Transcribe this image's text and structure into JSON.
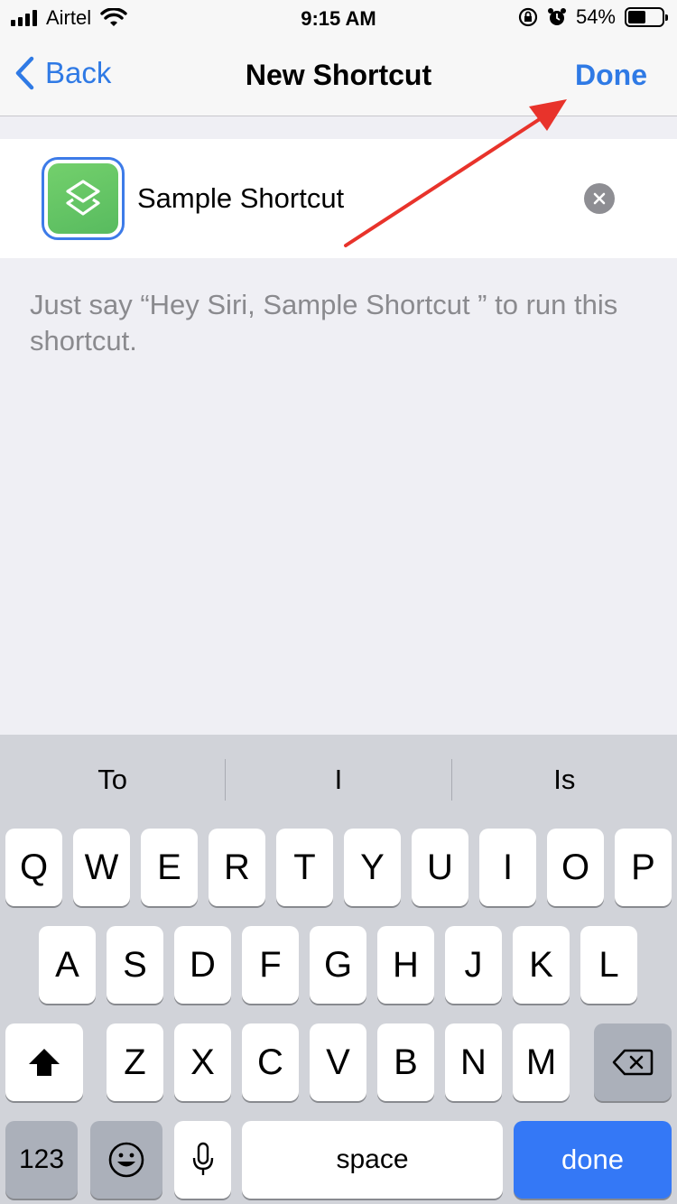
{
  "status_bar": {
    "carrier": "Airtel",
    "time": "9:15 AM",
    "battery_percent": "54%",
    "battery_level": 0.54
  },
  "nav": {
    "back_label": "Back",
    "title": "New Shortcut",
    "done_label": "Done"
  },
  "shortcut": {
    "name_value": "Sample Shortcut",
    "hint": "Just say “Hey Siri, Sample Shortcut ” to run this shortcut."
  },
  "keyboard": {
    "suggestions": [
      "To",
      "I",
      "Is"
    ],
    "row1": [
      "Q",
      "W",
      "E",
      "R",
      "T",
      "Y",
      "U",
      "I",
      "O",
      "P"
    ],
    "row2": [
      "A",
      "S",
      "D",
      "F",
      "G",
      "H",
      "J",
      "K",
      "L"
    ],
    "row3": [
      "Z",
      "X",
      "C",
      "V",
      "B",
      "N",
      "M"
    ],
    "numbers_label": "123",
    "space_label": "space",
    "done_label": "done"
  },
  "colors": {
    "accent": "#2f7ae5",
    "annotation_arrow": "#e8332b",
    "icon_green": "#62c466"
  },
  "icons": [
    "wifi-icon",
    "orientation-lock-icon",
    "alarm-icon",
    "chevron-left-icon",
    "shortcuts-app-icon",
    "clear-icon",
    "shift-icon",
    "backspace-icon",
    "emoji-icon",
    "microphone-icon"
  ]
}
